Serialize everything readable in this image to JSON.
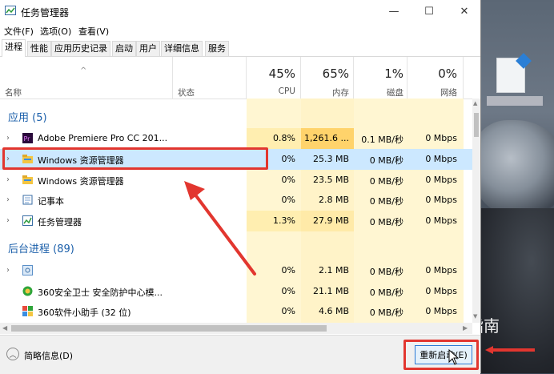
{
  "window": {
    "title": "任务管理器",
    "controls": {
      "minimize": "—",
      "maximize": "☐",
      "close": "✕"
    }
  },
  "menu": [
    "文件(F)",
    "选项(O)",
    "查看(V)"
  ],
  "tabs": [
    "进程",
    "性能",
    "应用历史记录",
    "启动",
    "用户",
    "详细信息",
    "服务"
  ],
  "header": {
    "name_label": "名称",
    "status_label": "状态",
    "cpu": {
      "percent": "45%",
      "label": "CPU"
    },
    "memory": {
      "percent": "65%",
      "label": "内存"
    },
    "disk": {
      "percent": "1%",
      "label": "磁盘"
    },
    "network": {
      "percent": "0%",
      "label": "网络"
    }
  },
  "groups": {
    "apps": "应用 (5)",
    "background": "后台进程 (89)"
  },
  "rows": [
    {
      "name": "Adobe Premiere Pro CC 201...",
      "cpu": "0.8%",
      "mem": "1,261.6 ...",
      "disk": "0.1 MB/秒",
      "net": "0 Mbps"
    },
    {
      "name": "Windows 资源管理器",
      "cpu": "0%",
      "mem": "25.3 MB",
      "disk": "0 MB/秒",
      "net": "0 Mbps"
    },
    {
      "name": "Windows 资源管理器",
      "cpu": "0%",
      "mem": "23.5 MB",
      "disk": "0 MB/秒",
      "net": "0 Mbps"
    },
    {
      "name": "记事本",
      "cpu": "0%",
      "mem": "2.8 MB",
      "disk": "0 MB/秒",
      "net": "0 Mbps"
    },
    {
      "name": "任务管理器",
      "cpu": "1.3%",
      "mem": "27.9 MB",
      "disk": "0 MB/秒",
      "net": "0 Mbps"
    },
    {
      "name": "",
      "cpu": "0%",
      "mem": "2.1 MB",
      "disk": "0 MB/秒",
      "net": "0 Mbps"
    },
    {
      "name": "360安全卫士 安全防护中心模...",
      "cpu": "0%",
      "mem": "21.1 MB",
      "disk": "0 MB/秒",
      "net": "0 Mbps"
    },
    {
      "name": "360软件小助手 (32 位)",
      "cpu": "0%",
      "mem": "4.6 MB",
      "disk": "0 MB/秒",
      "net": "0 Mbps"
    }
  ],
  "footer": {
    "brief": "简略信息(D)",
    "restart": "重新启动(E)"
  },
  "watermark": "搜狗指南",
  "colors": {
    "accent": "#1b5faa",
    "selected_row": "#cce8ff",
    "cpu_heat": "#fff4c4",
    "mem_heat_high": "#ffd36b",
    "annotation_red": "#e2362f"
  }
}
